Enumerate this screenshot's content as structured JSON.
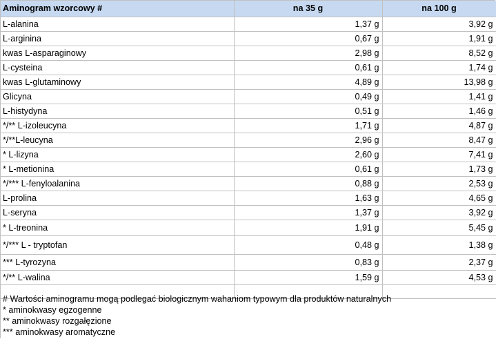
{
  "header": {
    "name": "Aminogram wzorcowy #",
    "col1": "na 35 g",
    "col2": "na 100 g"
  },
  "rows": [
    {
      "name": "L-alanina",
      "v35": "1,37 g",
      "v100": "3,92 g"
    },
    {
      "name": "L-arginina",
      "v35": "0,67 g",
      "v100": "1,91 g"
    },
    {
      "name": "kwas L-asparaginowy",
      "v35": "2,98 g",
      "v100": "8,52 g"
    },
    {
      "name": "L-cysteina",
      "v35": "0,61 g",
      "v100": "1,74 g"
    },
    {
      "name": "kwas L-glutaminowy",
      "v35": "4,89 g",
      "v100": "13,98 g"
    },
    {
      "name": "Glicyna",
      "v35": "0,49 g",
      "v100": "1,41 g"
    },
    {
      "name": "L-histydyna",
      "v35": "0,51 g",
      "v100": "1,46 g"
    },
    {
      "name": "*/** L-izoleucyna",
      "v35": "1,71 g",
      "v100": "4,87 g"
    },
    {
      "name": "*/**L-leucyna",
      "v35": "2,96 g",
      "v100": "8,47 g"
    },
    {
      "name": "* L-lizyna",
      "v35": "2,60 g",
      "v100": "7,41 g"
    },
    {
      "name": "* L-metionina",
      "v35": "0,61 g",
      "v100": "1,73 g"
    },
    {
      "name": "*/*** L-fenyloalanina",
      "v35": "0,88 g",
      "v100": "2,53 g"
    },
    {
      "name": "L-prolina",
      "v35": "1,63 g",
      "v100": "4,65 g"
    },
    {
      "name": "L-seryna",
      "v35": "1,37 g",
      "v100": "3,92 g"
    },
    {
      "name": "* L-treonina",
      "v35": "1,91 g",
      "v100": "5,45 g"
    },
    {
      "name": "*/*** L - tryptofan",
      "v35": "0,48 g",
      "v100": "1,38 g"
    },
    {
      "name": "*** L-tyrozyna",
      "v35": "0,83 g",
      "v100": "2,37 g"
    },
    {
      "name": "*/** L-walina",
      "v35": "1,59 g",
      "v100": "4,53 g"
    }
  ],
  "notes": [
    "# Wartości aminogramu mogą podlegać biologicznym wahaniom typowym dla produktów naturalnych",
    "* aminokwasy egzogenne",
    "** aminokwasy rozgałęzione",
    "*** aminokwasy aromatyczne"
  ],
  "colors": {
    "header_bg": "#c6d9f1",
    "grid": "#c0c0c0"
  }
}
